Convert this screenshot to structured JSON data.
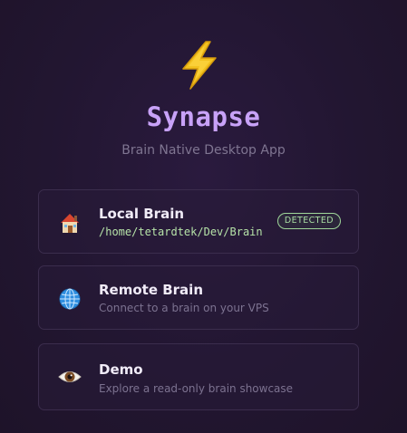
{
  "app": {
    "title": "Synapse",
    "subtitle": "Brain Native Desktop App",
    "logo_icon": "lightning-bolt-icon"
  },
  "colors": {
    "title": "#c8a2f8",
    "bolt": "#f3c21f",
    "badge": "#a9dfa3",
    "path": "#b6e3a8"
  },
  "options": [
    {
      "icon": "house-icon",
      "title": "Local Brain",
      "path": "/home/tetardtek/Dev/Brain",
      "badge": "DETECTED"
    },
    {
      "icon": "globe-icon",
      "title": "Remote Brain",
      "subtitle": "Connect to a brain on your VPS"
    },
    {
      "icon": "eye-icon",
      "title": "Demo",
      "subtitle": "Explore a read-only brain showcase"
    }
  ]
}
